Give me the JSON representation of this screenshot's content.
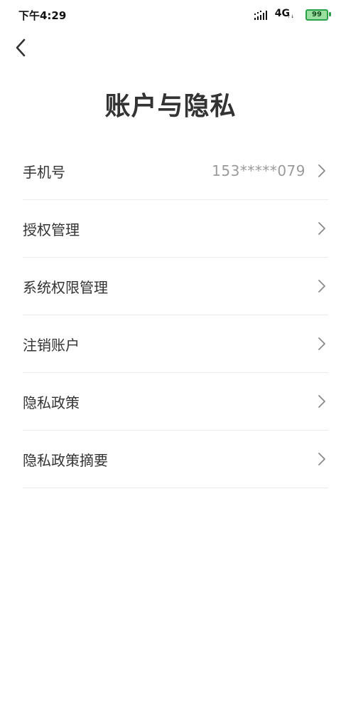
{
  "status_bar": {
    "time": "下午4:29",
    "network": "4G",
    "network_sub": "↑↓",
    "battery": "99",
    "battery_color": "#2aa04b"
  },
  "header": {
    "back_icon": "chevron-left-icon",
    "title": "账户与隐私"
  },
  "menu": {
    "items": [
      {
        "label": "手机号",
        "value": "153*****079"
      },
      {
        "label": "授权管理"
      },
      {
        "label": "系统权限管理"
      },
      {
        "label": "注销账户"
      },
      {
        "label": "隐私政策"
      },
      {
        "label": "隐私政策摘要"
      }
    ]
  }
}
